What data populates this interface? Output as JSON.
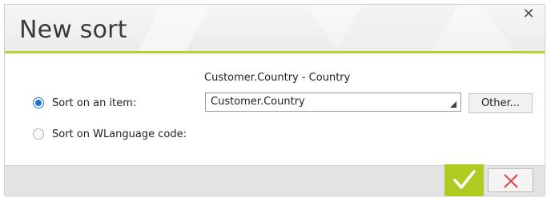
{
  "dialog": {
    "title": "New sort",
    "close_symbol": "✕"
  },
  "item_caption": "Customer.Country - Country",
  "options": [
    {
      "label": "Sort on an item:",
      "checked": true
    },
    {
      "label": "Sort on WLanguage code:",
      "checked": false
    }
  ],
  "item_select": {
    "value": "Customer.Country"
  },
  "other_button": {
    "label": "Other..."
  },
  "footer": {
    "ok_icon": "checkmark-icon",
    "cancel_icon": "cross-icon"
  },
  "colors": {
    "accent": "#b4d22a",
    "ok_bg": "#b0cc23",
    "cancel_icon": "#e04040",
    "radio_selected": "#1e74d8"
  }
}
